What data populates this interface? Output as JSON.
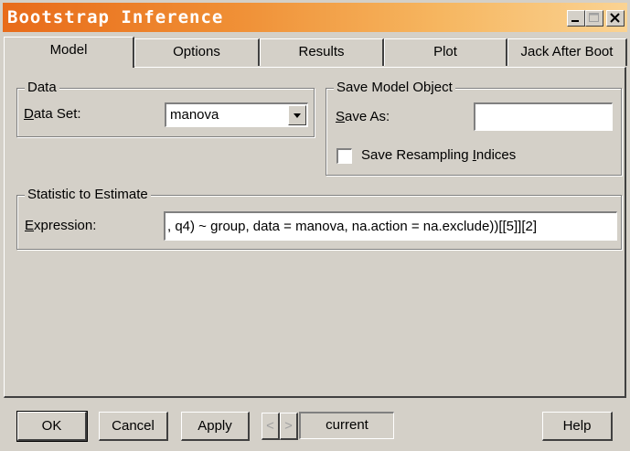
{
  "window": {
    "title": "Bootstrap Inference"
  },
  "tabs": [
    {
      "label": "Model"
    },
    {
      "label": "Options"
    },
    {
      "label": "Results"
    },
    {
      "label": "Plot"
    },
    {
      "label": "Jack After Boot"
    }
  ],
  "data_group": {
    "title": "Data",
    "data_set_label_u": "D",
    "data_set_label_rest": "ata Set:",
    "data_set_value": "manova"
  },
  "save_group": {
    "title": "Save Model Object",
    "save_as_label_u": "S",
    "save_as_label_rest": "ave As:",
    "save_as_value": "",
    "resampling_label_pre": "Save Resampling ",
    "resampling_label_u": "I",
    "resampling_label_post": "ndices",
    "resampling_checked": false
  },
  "statistic_group": {
    "title": "Statistic to Estimate",
    "expression_label_u": "E",
    "expression_label_rest": "xpression:",
    "expression_value": ", q4) ~ group, data = manova, na.action = na.exclude))[[5]][2]"
  },
  "bottom": {
    "ok": "OK",
    "cancel": "Cancel",
    "apply": "Apply",
    "prev": "<",
    "next": ">",
    "current": "current",
    "help": "Help"
  },
  "icons": {
    "minimize": "minimize-icon",
    "maximize": "maximize-icon",
    "close": "close-icon"
  }
}
